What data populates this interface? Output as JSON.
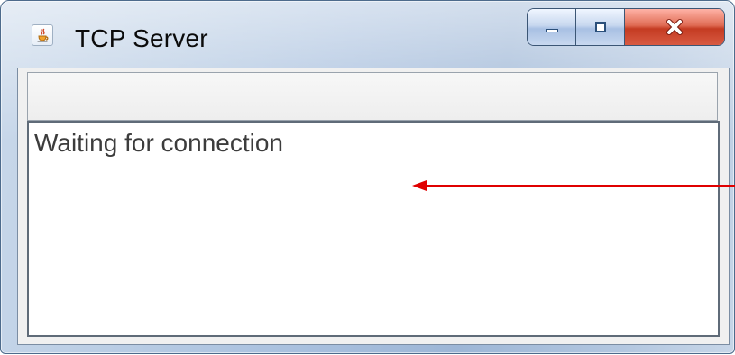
{
  "window": {
    "title": "TCP Server",
    "icon": "java-cup-icon"
  },
  "controls": {
    "minimize_icon": "minimize-icon",
    "maximize_icon": "maximize-icon",
    "close_icon": "close-icon"
  },
  "content": {
    "status_text": "Waiting for connection"
  },
  "colors": {
    "annotation_arrow": "#e00000"
  }
}
